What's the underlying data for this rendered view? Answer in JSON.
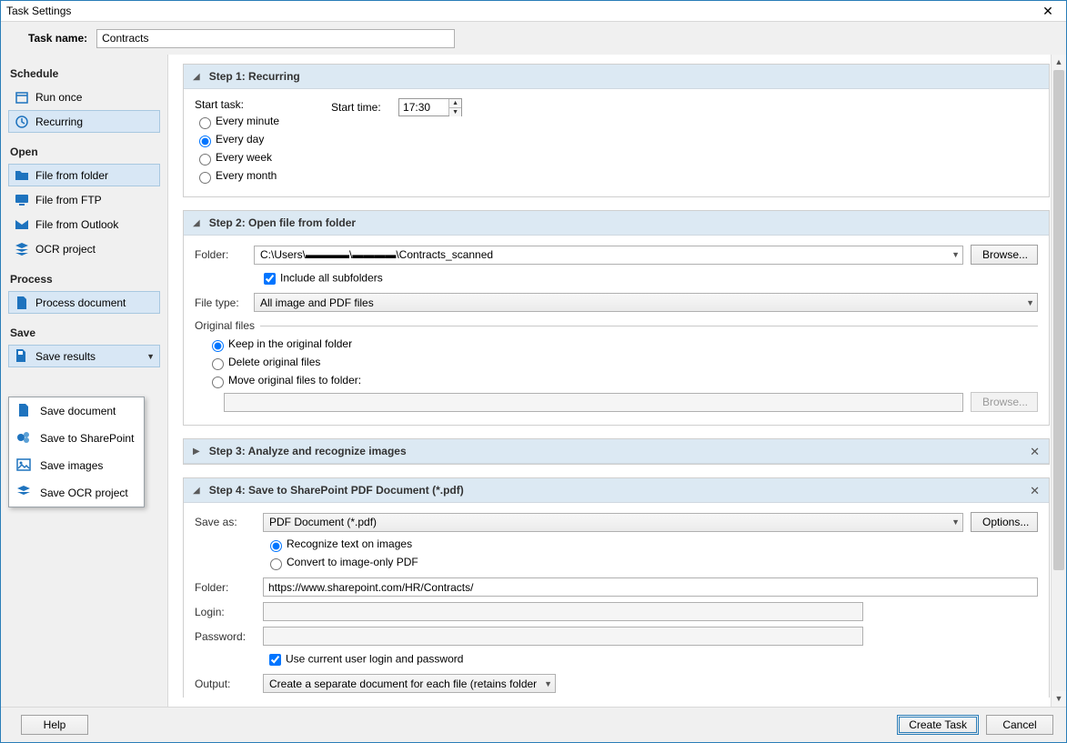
{
  "window": {
    "title": "Task Settings"
  },
  "taskName": {
    "label": "Task name:",
    "value": "Contracts"
  },
  "sidebar": {
    "schedule": {
      "title": "Schedule",
      "runOnce": "Run once",
      "recurring": "Recurring"
    },
    "open": {
      "title": "Open",
      "fileFromFolder": "File from folder",
      "fileFromFtp": "File from FTP",
      "fileFromOutlook": "File from Outlook",
      "ocrProject": "OCR project"
    },
    "process": {
      "title": "Process",
      "processDocument": "Process document"
    },
    "save": {
      "title": "Save",
      "saveResults": "Save results",
      "menu": {
        "saveDocument": "Save document",
        "saveToSharepoint": "Save to SharePoint",
        "saveImages": "Save images",
        "saveOcrProject": "Save OCR project"
      }
    }
  },
  "step1": {
    "title": "Step 1: Recurring",
    "startTaskLabel": "Start task:",
    "everyMinute": "Every minute",
    "everyDay": "Every day",
    "everyWeek": "Every week",
    "everyMonth": "Every month",
    "startTimeLabel": "Start time:",
    "startTimeValue": "17:30"
  },
  "step2": {
    "title": "Step 2: Open file from folder",
    "folderLabel": "Folder:",
    "folderValue": "C:\\Users\\▬▬▬▬\\▬▬▬▬\\Contracts_scanned",
    "browse": "Browse...",
    "includeSub": "Include all subfolders",
    "fileTypeLabel": "File type:",
    "fileTypeValue": "All image and PDF files",
    "originalFilesLegend": "Original files",
    "keepOriginal": "Keep in the original folder",
    "deleteOriginal": "Delete original files",
    "moveOriginal": "Move original files to folder:"
  },
  "step3": {
    "title": "Step 3: Analyze and recognize images"
  },
  "step4": {
    "title": "Step 4: Save to SharePoint PDF Document (*.pdf)",
    "saveAsLabel": "Save as:",
    "saveAsValue": "PDF Document (*.pdf)",
    "options": "Options...",
    "recognizeText": "Recognize text on images",
    "convertImageOnly": "Convert to image-only PDF",
    "folderLabel": "Folder:",
    "folderValue": "https://www.sharepoint.com/HR/Contracts/",
    "loginLabel": "Login:",
    "passwordLabel": "Password:",
    "useCurrentUser": "Use current user login and password",
    "outputLabel": "Output:",
    "outputValue": "Create a separate document for each file (retains folder hierar"
  },
  "footer": {
    "help": "Help",
    "createTask": "Create Task",
    "cancel": "Cancel"
  }
}
